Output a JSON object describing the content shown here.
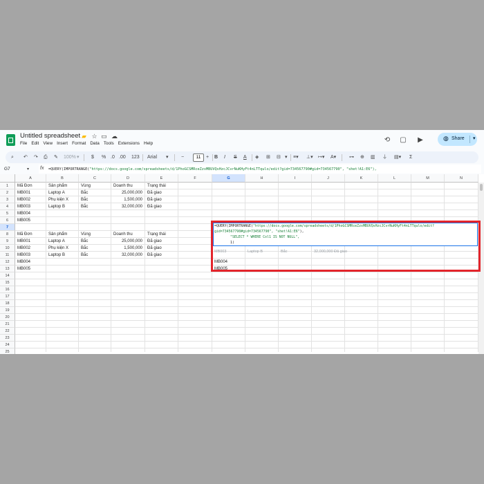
{
  "app": {
    "doc_title": "Untitled spreadsheet",
    "menu": [
      "File",
      "Edit",
      "View",
      "Insert",
      "Format",
      "Data",
      "Tools",
      "Extensions",
      "Help"
    ],
    "share_label": "Share"
  },
  "toolbar": {
    "zoom": "100%",
    "currency": "$",
    "percent": "%",
    "decimal_less": ".0",
    "decimal_more": ".00",
    "number_format": "123",
    "font": "Arial",
    "font_size": "11",
    "minus": "−",
    "plus": "+",
    "bold": "B",
    "italic": "I",
    "strike": "S",
    "text_color": "A"
  },
  "formula_bar": {
    "name_box": "G7",
    "fx": "fx",
    "fn_prefix": "=QUERY(IMPORTRANGE(",
    "url_literal": "\"https://docs.google.com/spreadsheets/d/1PhoGCSMRceZzxMBUVQsHzcJCvrNuKHyFt4nLTTqulo/edit?gid=734567790#gid=734567790\", \"shet!A1:E6\"),"
  },
  "grid": {
    "columns": [
      "A",
      "B",
      "C",
      "D",
      "E",
      "F",
      "G",
      "H",
      "I",
      "J",
      "K",
      "L",
      "M",
      "N"
    ],
    "rows": [
      "1",
      "2",
      "3",
      "4",
      "5",
      "6",
      "7",
      "8",
      "9",
      "10",
      "11",
      "12",
      "13",
      "14",
      "15",
      "16",
      "17",
      "18",
      "19",
      "20",
      "21",
      "22",
      "23",
      "24",
      "25"
    ],
    "active_cell": "G7"
  },
  "table1": {
    "headers": [
      "Mã Đơn",
      "Sản phẩm",
      "Vùng",
      "Doanh thu",
      "Trạng thái"
    ],
    "rows": [
      [
        "MB001",
        "Laptop A",
        "Bắc",
        "25,000,000",
        "Đã giao"
      ],
      [
        "MB002",
        "Phụ kiện X",
        "Bắc",
        "1,500,000",
        "Đã giao"
      ],
      [
        "MB003",
        "Laptop B",
        "Bắc",
        "32,000,000",
        "Đã giao"
      ],
      [
        "MB004",
        "",
        "",
        "",
        ""
      ],
      [
        "MB005",
        "",
        "",
        "",
        ""
      ]
    ]
  },
  "table2": {
    "headers": [
      "Mã Đơn",
      "Sản phẩm",
      "Vùng",
      "Doanh thu",
      "Trạng thái"
    ],
    "rows": [
      [
        "MB001",
        "Laptop A",
        "Bắc",
        "25,000,000",
        "Đã giao"
      ],
      [
        "MB002",
        "Phụ kiện X",
        "Bắc",
        "1,500,000",
        "Đã giao"
      ],
      [
        "MB003",
        "Laptop B",
        "Bắc",
        "32,000,000",
        "Đã giao"
      ],
      [
        "MB004",
        "",
        "",
        "",
        ""
      ],
      [
        "MB005",
        "",
        "",
        "",
        ""
      ]
    ]
  },
  "result_g": {
    "row11_faded": [
      "MB003",
      "Laptop B",
      "Bắc",
      "32,000,000 Đã giao"
    ],
    "row12": "MB004",
    "row13": "MB005"
  },
  "editor": {
    "line1_fn": "=QUERY(IMPORTRANGE(",
    "line1_str": "\"https://docs.google.com/spreadsheets/d/1PhoGCSMRceZzxMBUVQsHzcJCvrNuKHyFt4nLTTqulo/edit?",
    "line2_str": "gid=734567790#gid=734567790\", \"shet!A1:E6\"",
    "line2_end": "),",
    "line3": "\"SELECT * WHERE Col1 IS NOT NULL\",",
    "line4": "1)"
  },
  "colors": {
    "accent": "#1a73e8",
    "highlight_box": "#e3242b",
    "formula_string": "#188038",
    "share_bg": "#c2e7ff"
  }
}
